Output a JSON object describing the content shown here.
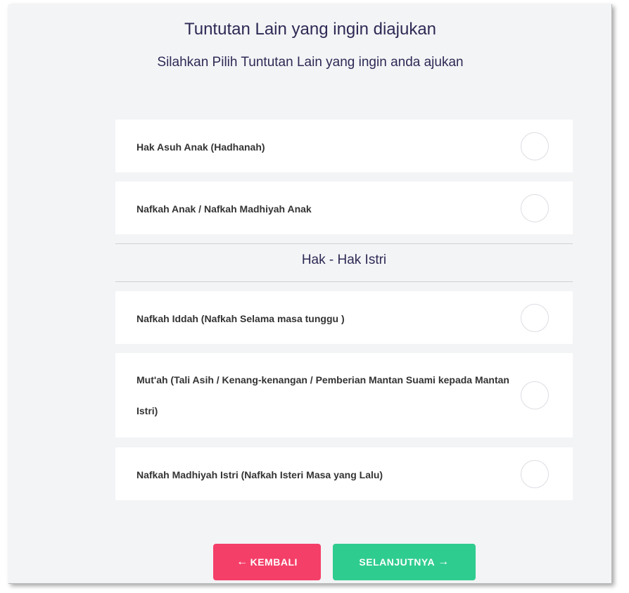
{
  "header": {
    "title": "Tuntutan Lain yang ingin diajukan",
    "subtitle": "Silahkan Pilih Tuntutan Lain yang ingin anda ajukan"
  },
  "options_children": [
    {
      "label": "Hak Asuh Anak (Hadhanah)",
      "selected": false
    },
    {
      "label": "Nafkah Anak / Nafkah Madhiyah Anak",
      "selected": false
    }
  ],
  "wife_rights": {
    "heading": "Hak - Hak Istri",
    "options": [
      {
        "label": "Nafkah Iddah (Nafkah Selama masa tunggu )",
        "selected": false
      },
      {
        "label": "Mut'ah (Tali Asih / Kenang-kenangan / Pemberian Mantan Suami kepada Mantan Istri)",
        "selected": false
      },
      {
        "label": "Nafkah Madhiyah Istri (Nafkah Isteri Masa yang Lalu)",
        "selected": false
      }
    ]
  },
  "buttons": {
    "back_label": "KEMBALI",
    "next_label": "SELANJUTNYA",
    "back_icon": "arrow-left-icon",
    "next_icon": "arrow-right-icon"
  },
  "colors": {
    "title_text": "#2d2a55",
    "back_button": "#f43f68",
    "next_button": "#2fcc8f",
    "background": "#f3f4f6"
  }
}
